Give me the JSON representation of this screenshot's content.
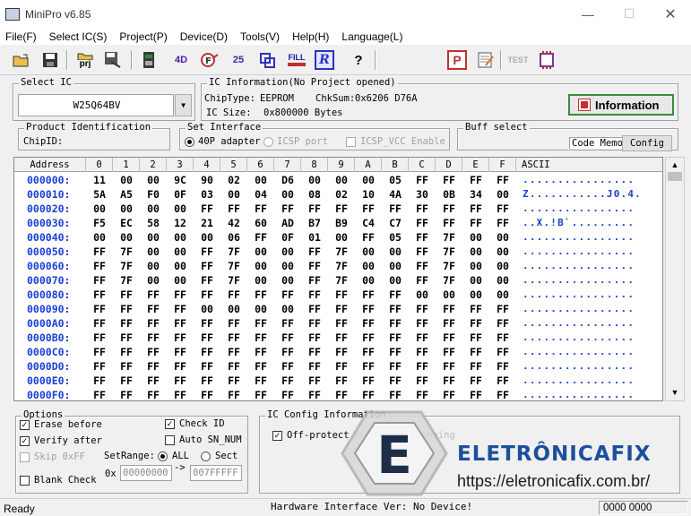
{
  "window": {
    "title": "MiniPro v6.85"
  },
  "menu": [
    "File(F)",
    "Select IC(S)",
    "Project(P)",
    "Device(D)",
    "Tools(V)",
    "Help(H)",
    "Language(L)"
  ],
  "toolbar": {
    "icons": [
      "open-icon",
      "save-icon",
      "project-icon",
      "save-project-icon",
      "device-icon",
      "read-icon",
      "verify-icon",
      "write-icon",
      "blank-check-icon",
      "fill-icon",
      "read-id-icon",
      "help-icon",
      "project-p-icon",
      "edit-icon",
      "test-icon",
      "chip-icon"
    ],
    "labels": {
      "project": "prj",
      "fill": "FILL",
      "read_id": "R",
      "help": "?",
      "test": "TEST",
      "project_p": "P",
      "device": "4D",
      "write": "25"
    }
  },
  "select_ic": {
    "label": "Select IC",
    "value": "W25Q64BV"
  },
  "ic_info": {
    "label": "IC Information(No Project opened)",
    "chiptype_label": "ChipType:",
    "chiptype": "EEPROM",
    "chksum_label": "ChkSum:",
    "chksum": "0x6206 D76A",
    "size_label": "IC Size:",
    "size": "0x800000 Bytes",
    "info_button": "Information"
  },
  "product_id": {
    "label": "Product Identification",
    "chipid_label": "ChipID:"
  },
  "set_interface": {
    "label": "Set Interface",
    "opt1": "40P adapter",
    "opt2": "ICSP port",
    "opt3": "ICSP_VCC Enable"
  },
  "buff_select": {
    "label": "Buff select",
    "code": "Code",
    "memo": "Memo",
    "config": "Config"
  },
  "hex": {
    "headers": [
      "Address",
      "0",
      "1",
      "2",
      "3",
      "4",
      "5",
      "6",
      "7",
      "8",
      "9",
      "A",
      "B",
      "C",
      "D",
      "E",
      "F",
      "ASCII"
    ],
    "rows": [
      {
        "addr": "000000:",
        "bytes": [
          "11",
          "00",
          "00",
          "9C",
          "90",
          "02",
          "00",
          "D6",
          "00",
          "00",
          "00",
          "05",
          "FF",
          "FF",
          "FF",
          "FF"
        ],
        "ascii": "................"
      },
      {
        "addr": "000010:",
        "bytes": [
          "5A",
          "A5",
          "F0",
          "0F",
          "03",
          "00",
          "04",
          "00",
          "08",
          "02",
          "10",
          "4A",
          "30",
          "0B",
          "34",
          "00"
        ],
        "ascii": "Z...........J0.4."
      },
      {
        "addr": "000020:",
        "bytes": [
          "00",
          "00",
          "00",
          "00",
          "FF",
          "FF",
          "FF",
          "FF",
          "FF",
          "FF",
          "FF",
          "FF",
          "FF",
          "FF",
          "FF",
          "FF"
        ],
        "ascii": "................"
      },
      {
        "addr": "000030:",
        "bytes": [
          "F5",
          "EC",
          "58",
          "12",
          "21",
          "42",
          "60",
          "AD",
          "B7",
          "B9",
          "C4",
          "C7",
          "FF",
          "FF",
          "FF",
          "FF"
        ],
        "ascii": "..X.!B`........."
      },
      {
        "addr": "000040:",
        "bytes": [
          "00",
          "00",
          "00",
          "00",
          "00",
          "06",
          "FF",
          "0F",
          "01",
          "00",
          "FF",
          "05",
          "FF",
          "7F",
          "00",
          "00"
        ],
        "ascii": "................"
      },
      {
        "addr": "000050:",
        "bytes": [
          "FF",
          "7F",
          "00",
          "00",
          "FF",
          "7F",
          "00",
          "00",
          "FF",
          "7F",
          "00",
          "00",
          "FF",
          "7F",
          "00",
          "00"
        ],
        "ascii": "................"
      },
      {
        "addr": "000060:",
        "bytes": [
          "FF",
          "7F",
          "00",
          "00",
          "FF",
          "7F",
          "00",
          "00",
          "FF",
          "7F",
          "00",
          "00",
          "FF",
          "7F",
          "00",
          "00"
        ],
        "ascii": "................"
      },
      {
        "addr": "000070:",
        "bytes": [
          "FF",
          "7F",
          "00",
          "00",
          "FF",
          "7F",
          "00",
          "00",
          "FF",
          "7F",
          "00",
          "00",
          "FF",
          "7F",
          "00",
          "00"
        ],
        "ascii": "................"
      },
      {
        "addr": "000080:",
        "bytes": [
          "FF",
          "FF",
          "FF",
          "FF",
          "FF",
          "FF",
          "FF",
          "FF",
          "FF",
          "FF",
          "FF",
          "FF",
          "00",
          "00",
          "00",
          "00"
        ],
        "ascii": "................"
      },
      {
        "addr": "000090:",
        "bytes": [
          "FF",
          "FF",
          "FF",
          "FF",
          "00",
          "00",
          "00",
          "00",
          "FF",
          "FF",
          "FF",
          "FF",
          "FF",
          "FF",
          "FF",
          "FF"
        ],
        "ascii": "................"
      },
      {
        "addr": "0000A0:",
        "bytes": [
          "FF",
          "FF",
          "FF",
          "FF",
          "FF",
          "FF",
          "FF",
          "FF",
          "FF",
          "FF",
          "FF",
          "FF",
          "FF",
          "FF",
          "FF",
          "FF"
        ],
        "ascii": "................"
      },
      {
        "addr": "0000B0:",
        "bytes": [
          "FF",
          "FF",
          "FF",
          "FF",
          "FF",
          "FF",
          "FF",
          "FF",
          "FF",
          "FF",
          "FF",
          "FF",
          "FF",
          "FF",
          "FF",
          "FF"
        ],
        "ascii": "................"
      },
      {
        "addr": "0000C0:",
        "bytes": [
          "FF",
          "FF",
          "FF",
          "FF",
          "FF",
          "FF",
          "FF",
          "FF",
          "FF",
          "FF",
          "FF",
          "FF",
          "FF",
          "FF",
          "FF",
          "FF"
        ],
        "ascii": "................"
      },
      {
        "addr": "0000D0:",
        "bytes": [
          "FF",
          "FF",
          "FF",
          "FF",
          "FF",
          "FF",
          "FF",
          "FF",
          "FF",
          "FF",
          "FF",
          "FF",
          "FF",
          "FF",
          "FF",
          "FF"
        ],
        "ascii": "................"
      },
      {
        "addr": "0000E0:",
        "bytes": [
          "FF",
          "FF",
          "FF",
          "FF",
          "FF",
          "FF",
          "FF",
          "FF",
          "FF",
          "FF",
          "FF",
          "FF",
          "FF",
          "FF",
          "FF",
          "FF"
        ],
        "ascii": "................"
      },
      {
        "addr": "0000F0:",
        "bytes": [
          "FF",
          "FF",
          "FF",
          "FF",
          "FF",
          "FF",
          "FF",
          "FF",
          "FF",
          "FF",
          "FF",
          "FF",
          "FF",
          "FF",
          "FF",
          "FF"
        ],
        "ascii": "................"
      }
    ]
  },
  "options": {
    "label": "Options",
    "erase_before": "Erase before",
    "verify_after": "Verify after",
    "skip_0xff": "Skip 0xFF",
    "blank_check": "Blank Check",
    "check_id": "Check ID",
    "auto_sn": "Auto SN_NUM",
    "setrange": "SetRange:",
    "all": "ALL",
    "sect": "Sect",
    "ox": "0x",
    "range_from": "00000000",
    "range_arrow": "->",
    "range_to": "007FFFFF"
  },
  "ic_config": {
    "label": "IC Config Information",
    "off_protect": "Off-protect",
    "faded_text": "before programming"
  },
  "status": {
    "ready": "Ready",
    "hw": "Hardware Interface Ver: No Device!",
    "code": "0000 0000"
  },
  "watermark": {
    "brand": "ELETRÔNICAFIX",
    "url": "https://eletronicafix.com.br/",
    "letter": "E"
  },
  "colors": {
    "address_blue": "#1a3fd6",
    "info_button_border": "#3c8a3c",
    "brand_blue": "#1d4f9c"
  }
}
